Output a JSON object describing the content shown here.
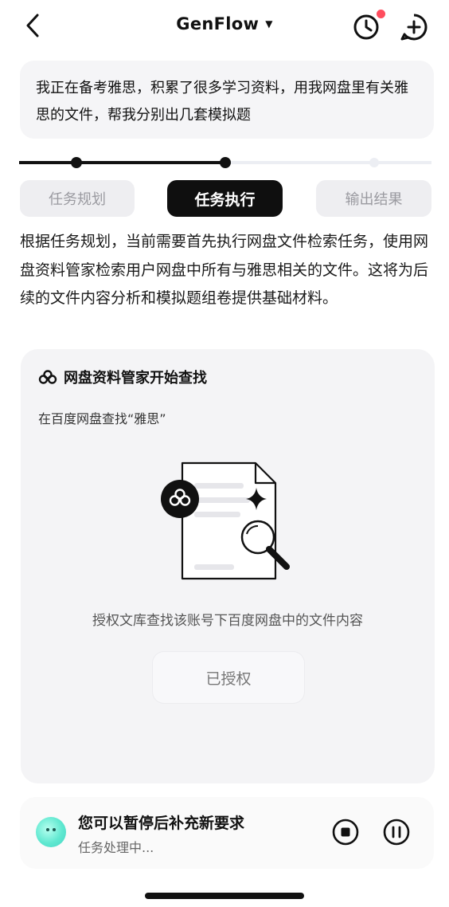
{
  "header": {
    "title": "GenFlow",
    "caret": "▼",
    "has_notification": true
  },
  "query": {
    "text": "我正在备考雅思，积累了很多学习资料，用我网盘里有关雅思的文件，帮我分别出几套模拟题"
  },
  "progress": {
    "completed_fraction": 0.5,
    "steps_reached": 2,
    "total_markers": 3
  },
  "steps": [
    {
      "label": "任务规划",
      "state": "inactive"
    },
    {
      "label": "任务执行",
      "state": "active"
    },
    {
      "label": "输出结果",
      "state": "inactive"
    }
  ],
  "description": "根据任务规划，当前需要首先执行网盘文件检索任务，使用网盘资料管家检索用户网盘中所有与雅思相关的文件。这将为后续的文件内容分析和模拟题组卷提供基础材料。",
  "tool_card": {
    "title": "网盘资料管家开始查找",
    "subtitle": "在百度网盘查找“雅思”",
    "auth_text": "授权文库查找该账号下百度网盘中的文件内容",
    "auth_button": "已授权"
  },
  "bottom_bar": {
    "title": "您可以暂停后补充新要求",
    "status": "任务处理中..."
  },
  "colors": {
    "accent": "#0f0f0f",
    "notification": "#ff4d5e",
    "avatar": "#5fe8d0"
  },
  "icons": [
    "back-chevron-icon",
    "caret-down-icon",
    "history-clock-icon",
    "new-chat-icon",
    "cloud-drive-icon",
    "document-search-icon",
    "sparkle-icon",
    "stop-icon",
    "pause-icon"
  ]
}
